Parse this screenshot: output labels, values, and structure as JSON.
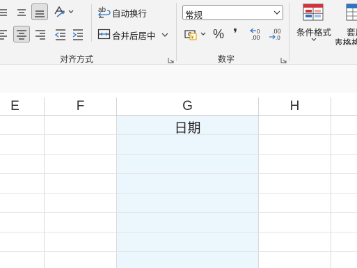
{
  "ribbon": {
    "alignment": {
      "wrap_text_label": "自动换行",
      "merge_center_label": "合并后居中",
      "group_label": "对齐方式"
    },
    "number": {
      "format_value": "常规",
      "percent_glyph": "%",
      "comma_glyph": "❜",
      "group_label": "数字"
    },
    "styles": {
      "conditional_format_label": "条件格式",
      "table_format_label_top": "套用",
      "table_format_label_bottom": "表格格"
    }
  },
  "grid": {
    "columns": [
      "E",
      "F",
      "G",
      "H"
    ],
    "selected_column": "G",
    "cells": {
      "G1": "日期"
    }
  },
  "colors": {
    "ribbon_bg": "#f3f3f3",
    "selection_fill": "#ecf6fd",
    "accent_blue": "#2e74c0",
    "accent_red": "#d13438"
  }
}
